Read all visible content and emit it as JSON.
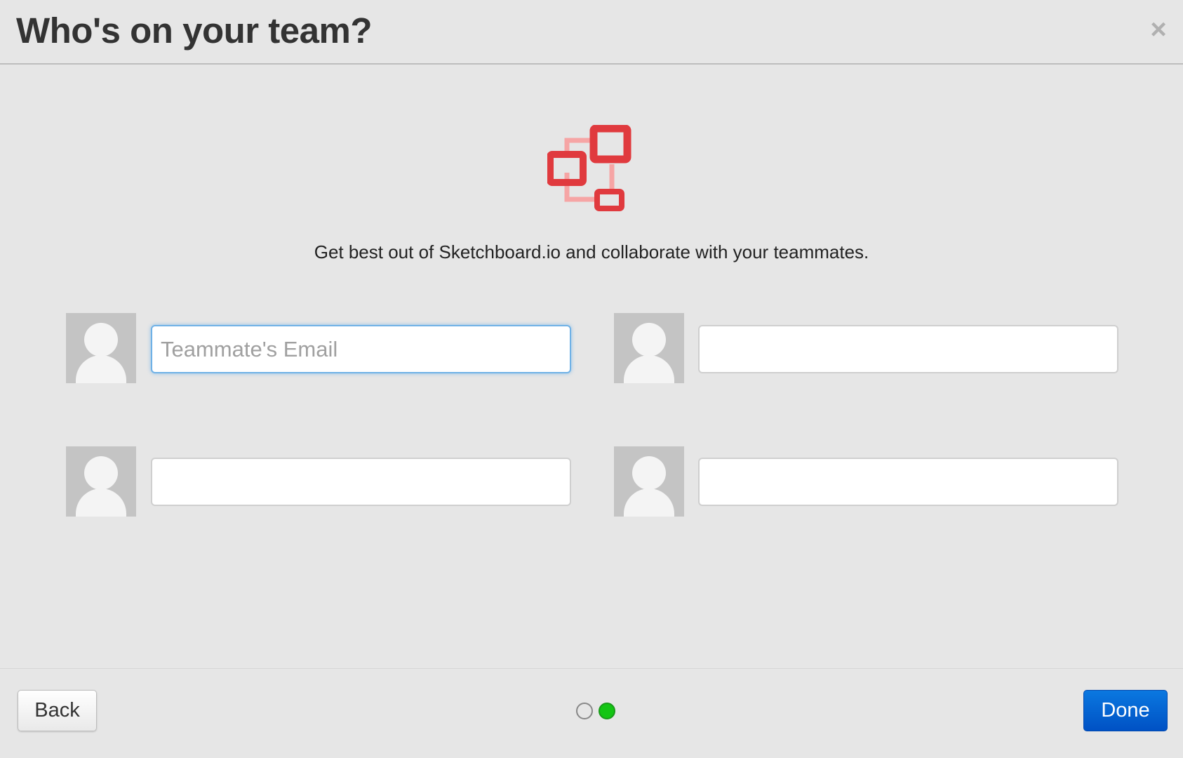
{
  "header": {
    "title": "Who's on your team?",
    "close_glyph": "×"
  },
  "logo": {
    "icon": "sketchboard-logo-icon",
    "primary_color": "#e03a3e",
    "secondary_color": "#f6a5a5"
  },
  "subtitle": "Get best out of Sketchboard.io and collaborate with your teammates.",
  "invites": [
    {
      "placeholder": "Teammate's Email",
      "value": "",
      "focused": true
    },
    {
      "placeholder": "",
      "value": "",
      "focused": false
    },
    {
      "placeholder": "",
      "value": "",
      "focused": false
    },
    {
      "placeholder": "",
      "value": "",
      "focused": false
    }
  ],
  "footer": {
    "back_label": "Back",
    "done_label": "Done",
    "steps": {
      "total": 2,
      "current": 2,
      "active_color": "#14c514"
    }
  }
}
